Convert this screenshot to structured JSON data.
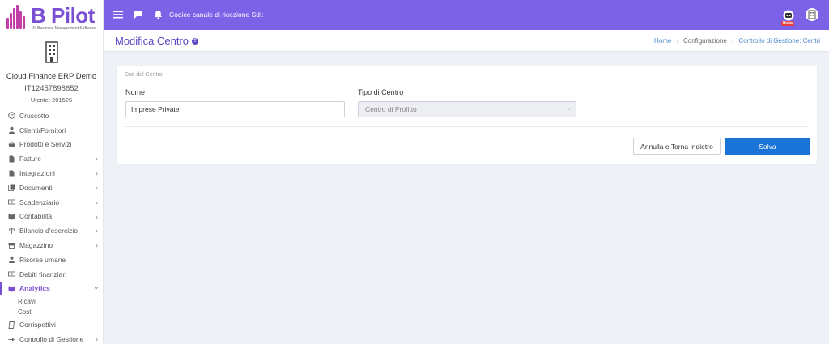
{
  "brand": {
    "logo_text": "B Pilot",
    "logo_subtitle": "AI Business Management Software",
    "accent": "#7b62e6",
    "logo_color": "#c13fa6"
  },
  "company": {
    "name": "Cloud Finance ERP Demo",
    "vat": "IT12457898652",
    "user": "Utente: 201526"
  },
  "sidebar": {
    "items": [
      {
        "label": "Cruscotto",
        "icon": "dashboard-icon",
        "chevron": false
      },
      {
        "label": "Clienti/Fornitori",
        "icon": "user-icon",
        "chevron": false
      },
      {
        "label": "Prodotti e Servizi",
        "icon": "basket-icon",
        "chevron": false
      },
      {
        "label": "Fatture",
        "icon": "file-icon",
        "chevron": true
      },
      {
        "label": "Integrazioni",
        "icon": "file-icon",
        "chevron": true
      },
      {
        "label": "Documenti",
        "icon": "documents-icon",
        "chevron": true
      },
      {
        "label": "Scadenziario",
        "icon": "money-icon",
        "chevron": true
      },
      {
        "label": "Contabilità",
        "icon": "book-icon",
        "chevron": true
      },
      {
        "label": "Bilancio d'esercizio",
        "icon": "scale-icon",
        "chevron": true
      },
      {
        "label": "Magazzino",
        "icon": "warehouse-icon",
        "chevron": true
      },
      {
        "label": "Risorse umane",
        "icon": "user-icon",
        "chevron": false
      },
      {
        "label": "Debiti finanziari",
        "icon": "money-icon",
        "chevron": false
      },
      {
        "label": "Analytics",
        "icon": "book-icon",
        "chevron": true,
        "active": true
      }
    ],
    "analytics_sub": [
      "Ricavi",
      "Costi"
    ],
    "bottom_items": [
      {
        "label": "Corrispettivi",
        "icon": "receipt-icon",
        "chevron": false
      },
      {
        "label": "Controllo di Gestione",
        "icon": "arrow-right-icon",
        "chevron": true
      }
    ]
  },
  "topbar": {
    "channel_text": "Codice canale di ricezione SdI:",
    "beta_label": "Beta"
  },
  "header": {
    "title": "Modifica Centro",
    "breadcrumb": [
      "Home",
      "Configurazione",
      "Controllo di Gestione: Centri"
    ]
  },
  "form": {
    "section_title": "Dati del Centro",
    "name_label": "Nome",
    "name_value": "Imprese Private",
    "type_label": "Tipo di Centro",
    "type_value": "Centro di Profitto",
    "cancel_label": "Annulla e Torna Indietro",
    "save_label": "Salva"
  }
}
